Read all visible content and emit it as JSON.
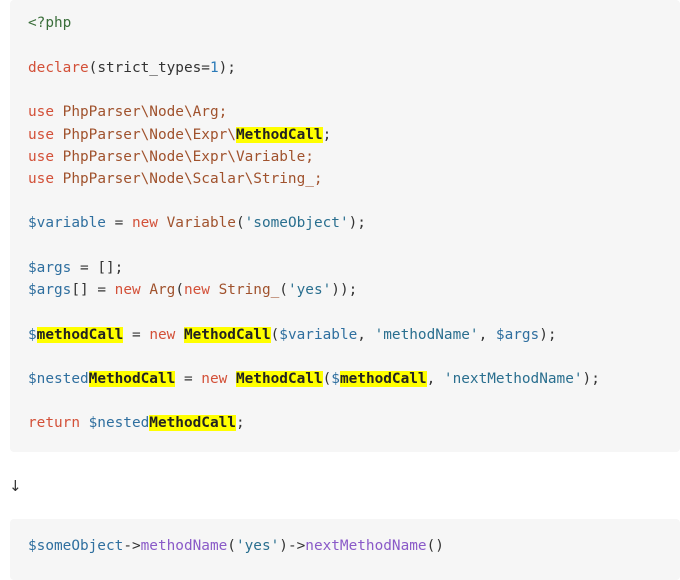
{
  "code_top": {
    "l1": "<?php",
    "l2_fn": "declare",
    "l2_open": "(strict_types=",
    "l2_num": "1",
    "l2_close": ");",
    "use_kw": "use",
    "l3_ns": " PhpParser\\Node\\Arg;",
    "l4_ns": " PhpParser\\Node\\Expr\\",
    "l4_hl": "MethodCall",
    "l4_end": ";",
    "l5_ns": " PhpParser\\Node\\Expr\\Variable;",
    "l6_ns": " PhpParser\\Node\\Scalar\\String_;",
    "l7_var": "$variable",
    "l7_eq": " = ",
    "new_kw": "new",
    "l7_cls": " Variable",
    "l7_open": "(",
    "l7_str": "'someObject'",
    "l7_close": ");",
    "l8_var": "$args",
    "l8_rest": " = [];",
    "l9_var": "$args",
    "l9_br": "[] = ",
    "l9_cls1": " Arg",
    "l9_open1": "(",
    "l9_cls2": " String_",
    "l9_open2": "(",
    "l9_str": "'yes'",
    "l9_close": "));",
    "l10_dollar": "$",
    "l10_hl": "methodCall",
    "l10_eq": " = ",
    "l10_sp": " ",
    "l10_hl2": "MethodCall",
    "l10_open": "(",
    "l10_var1": "$variable",
    "l10_comma1": ", ",
    "l10_str": "'methodName'",
    "l10_comma2": ", ",
    "l10_var2": "$args",
    "l10_close": ");",
    "l11_var": "$nested",
    "l11_hl": "MethodCall",
    "l11_eq": " = ",
    "l11_sp": " ",
    "l11_hl2": "MethodCall",
    "l11_open": "(",
    "l11_dollar": "$",
    "l11_hl3": "methodCall",
    "l11_comma": ", ",
    "l11_str": "'nextMethodName'",
    "l11_close": ");",
    "return_kw": "return",
    "l12_var": " $nested",
    "l12_hl": "MethodCall",
    "l12_end": ";"
  },
  "arrow": "↓",
  "code_bottom": {
    "var": "$someObject",
    "arrow_op": "->",
    "meth1": "methodName",
    "open": "(",
    "str": "'yes'",
    "close_arrow": ")->",
    "meth2": "nextMethodName",
    "end": "()"
  }
}
